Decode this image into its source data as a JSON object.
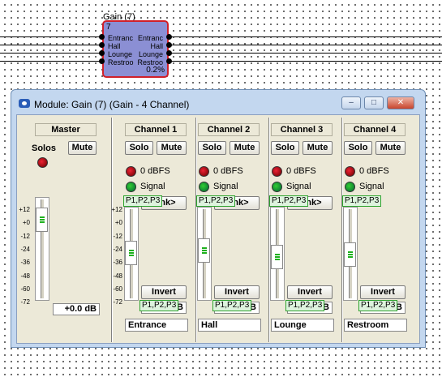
{
  "block": {
    "title": "Gain (7)",
    "number": "7",
    "inputs": [
      "Entranc",
      "Hall",
      "Lounge",
      "Restroo"
    ],
    "outputs": [
      "Entranc",
      "Hall",
      "Lounge",
      "Restroo"
    ],
    "percent": "0.2%"
  },
  "window": {
    "title": "Module: Gain (7) (Gain - 4 Channel)",
    "buttons": {
      "minimize": "–",
      "maximize": "□",
      "close": "✕"
    }
  },
  "master": {
    "header": "Master",
    "solos_label": "Solos",
    "mute_label": "Mute",
    "scale": [
      "+12",
      "+0",
      "-12",
      "-24",
      "-36",
      "-48",
      "-60",
      "-72"
    ],
    "value": "+0.0 dB",
    "fader_level_db": 0
  },
  "channels": [
    {
      "header": "Channel 1",
      "solo": "Solo",
      "mute": "Mute",
      "dbfs": "0 dBFS",
      "signal": "Signal",
      "link": "Link>",
      "tag_top": "P1,P2,P3",
      "invert": "Invert",
      "tag_bottom": "P1,P2,P3",
      "value_suffix": "B",
      "name": "Entrance"
    },
    {
      "header": "Channel 2",
      "solo": "Solo",
      "mute": "Mute",
      "dbfs": "0 dBFS",
      "signal": "Signal",
      "link": "Link>",
      "tag_top": "P1,P2,P3",
      "invert": "Invert",
      "tag_bottom": "P1,P2,P3",
      "value_suffix": "dB",
      "name": "Hall"
    },
    {
      "header": "Channel 3",
      "solo": "Solo",
      "mute": "Mute",
      "dbfs": "0 dBFS",
      "signal": "Signal",
      "link": "Link>",
      "tag_top": "P1,P2,P3",
      "invert": "Invert",
      "tag_bottom": "P1,P2,P3",
      "value_suffix": "dB",
      "name": "Lounge"
    },
    {
      "header": "Channel 4",
      "solo": "Solo",
      "mute": "Mute",
      "dbfs": "0 dBFS",
      "signal": "Signal",
      "link": "",
      "tag_top": "P1,P2,P3",
      "invert": "Invert",
      "tag_bottom": "P1,P2,P3",
      "value_suffix": "dB",
      "name": "Restroom"
    }
  ],
  "channel1_scale": [
    "+12",
    "+0",
    "-12",
    "-24",
    "-36",
    "-48",
    "-60",
    "-72"
  ],
  "colors": {
    "block_fill": "#8b8fd4",
    "block_border": "#d0202a",
    "tag_border": "#2fa32f",
    "led_red": "#dd2222",
    "led_green": "#22aa22"
  }
}
